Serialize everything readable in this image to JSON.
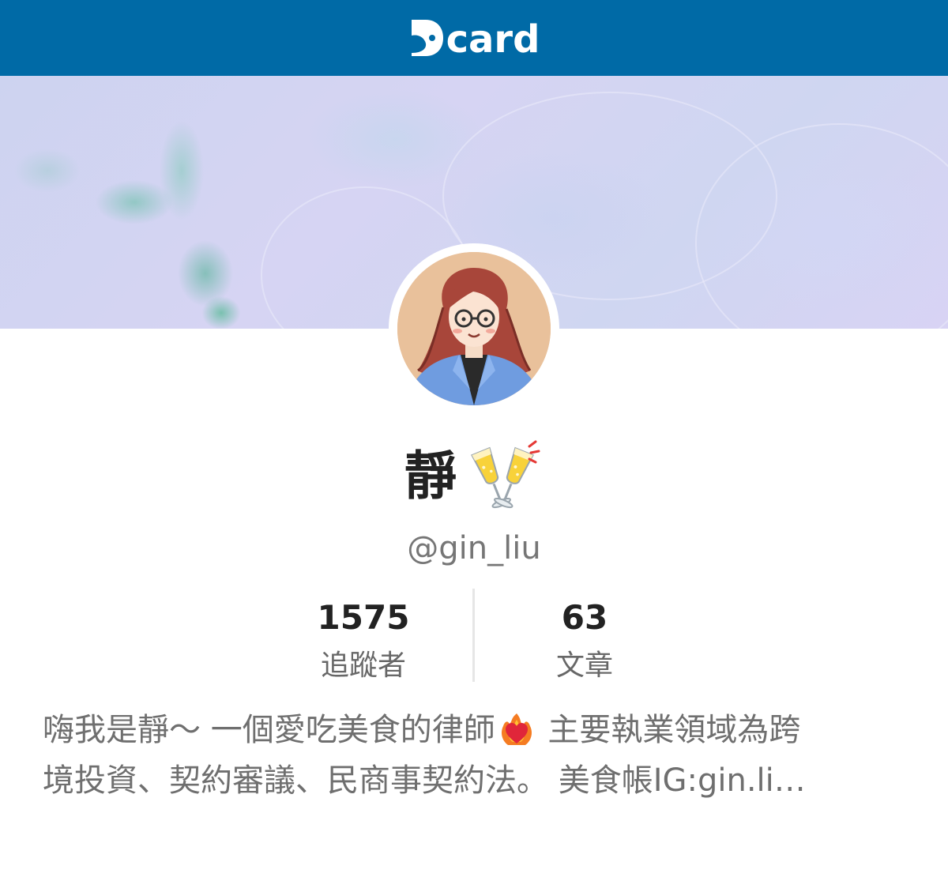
{
  "header": {
    "brand_mark": "D",
    "brand_text": "card",
    "brand_color": "#006aa6"
  },
  "cover": {
    "palette": [
      "#cdd3f0",
      "#d6d4f3",
      "#5fbea0"
    ]
  },
  "profile": {
    "avatar_icon": "avatar-woman-glasses-icon",
    "name": "靜",
    "name_emoji_icon": "clinking-glasses-icon",
    "handle": "@gin_liu",
    "stats": [
      {
        "value": "1575",
        "label": "追蹤者"
      },
      {
        "value": "63",
        "label": "文章"
      }
    ],
    "bio": {
      "line1_before": "嗨我是靜～ 一個愛吃美食的律師",
      "line1_after": " 主要執業領域為跨",
      "line2": "境投資、契約審議、民商事契約法。 美食帳IG:gin.li…",
      "heart_icon": "heart-on-fire-icon"
    }
  }
}
